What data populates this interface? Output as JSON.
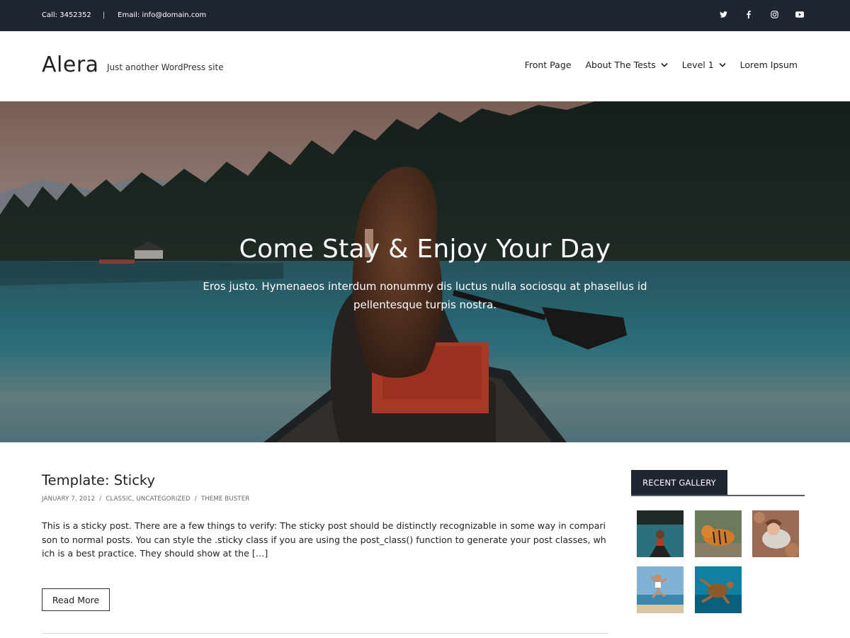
{
  "topbar": {
    "call": "Call: 3452352",
    "separator": "|",
    "email": "Email: info@domain.com",
    "social": [
      "twitter-icon",
      "facebook-icon",
      "instagram-icon",
      "youtube-icon"
    ]
  },
  "header": {
    "site_title": "Alera",
    "tagline": "Just another WordPress site",
    "nav": [
      {
        "label": "Front Page",
        "has_dropdown": false
      },
      {
        "label": "About The Tests",
        "has_dropdown": true
      },
      {
        "label": "Level 1",
        "has_dropdown": true
      },
      {
        "label": "Lorem Ipsum",
        "has_dropdown": false
      }
    ]
  },
  "hero": {
    "title": "Come Stay & Enjoy Your Day",
    "subtitle": "Eros justo. Hymenaeos interdum nonummy dis luctus nulla sociosqu at phasellus id pellentesque turpis nostra."
  },
  "post": {
    "title": "Template: Sticky",
    "date": "JANUARY 7, 2012",
    "categories": "CLASSIC, UNCATEGORIZED",
    "author": "THEME BUSTER",
    "slash": "/",
    "excerpt": "This is a sticky post. There are a few things to verify: The sticky post should be distinctly recognizable in some way in comparison to normal posts. You can style the .sticky class if you are using the post_class() function to generate your post classes, which is a best practice. They should show at the […]",
    "read_more": "Read More"
  },
  "sidebar": {
    "widget_title": "RECENT GALLERY",
    "gallery": [
      "canoe-lake-photo",
      "tiger-photo",
      "woman-lying-photo",
      "beach-jump-photo",
      "sea-turtle-photo"
    ]
  },
  "colors": {
    "dark": "#1f2532",
    "text": "#222222"
  }
}
